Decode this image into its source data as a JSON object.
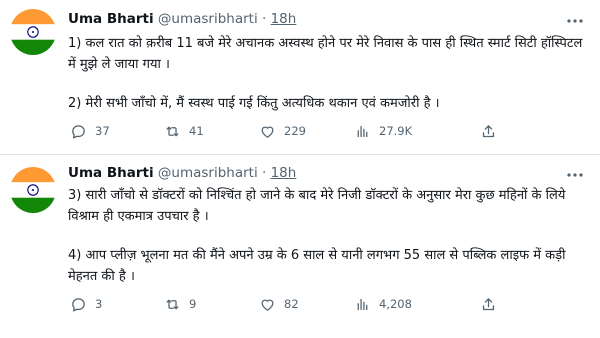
{
  "tweets": [
    {
      "name": "Uma Bharti",
      "handle": "@umasribharti",
      "separator": "·",
      "time": "18h",
      "paragraphs": [
        "1) कल रात को क़रीब 11 बजे मेरे अचानक अस्वस्थ होने पर मेरे निवास के पास ही स्थित स्मार्ट सिटी हॉस्पिटल में मुझे ले जाया गया ।",
        "2) मेरी सभी जाँचो में, मैं स्वस्थ पाई गई किंतु अत्यधिक थकान एवं कमजोरी है ।"
      ],
      "replies": "37",
      "retweets": "41",
      "likes": "229",
      "views": "27.9K"
    },
    {
      "name": "Uma Bharti",
      "handle": "@umasribharti",
      "separator": "·",
      "time": "18h",
      "paragraphs": [
        "3) सारी जाँचो से डॉक्टरों को निश्चिंत हो जाने के बाद मेरे निजी डॉक्टरों के अनुसार मेरा कुछ महिनों के लिये विश्राम ही एकमात्र उपचार है ।",
        "4) आप प्लीज़ भूलना मत की मैंने अपने उम्र के 6 साल से यानी लगभग 55 साल से पब्लिक लाइफ में कड़ी मेहनत की है ।"
      ],
      "replies": "3",
      "retweets": "9",
      "likes": "82",
      "views": "4,208"
    }
  ],
  "icons": {
    "reply": "reply-icon",
    "retweet": "retweet-icon",
    "like": "heart-icon",
    "views": "views-icon",
    "share": "share-icon",
    "more": "more-icon",
    "avatar": "india-flag-avatar"
  },
  "colors": {
    "saffron": "#FF9933",
    "green": "#138808",
    "chakra": "#000080",
    "muted": "#536471",
    "text": "#0f1419"
  }
}
